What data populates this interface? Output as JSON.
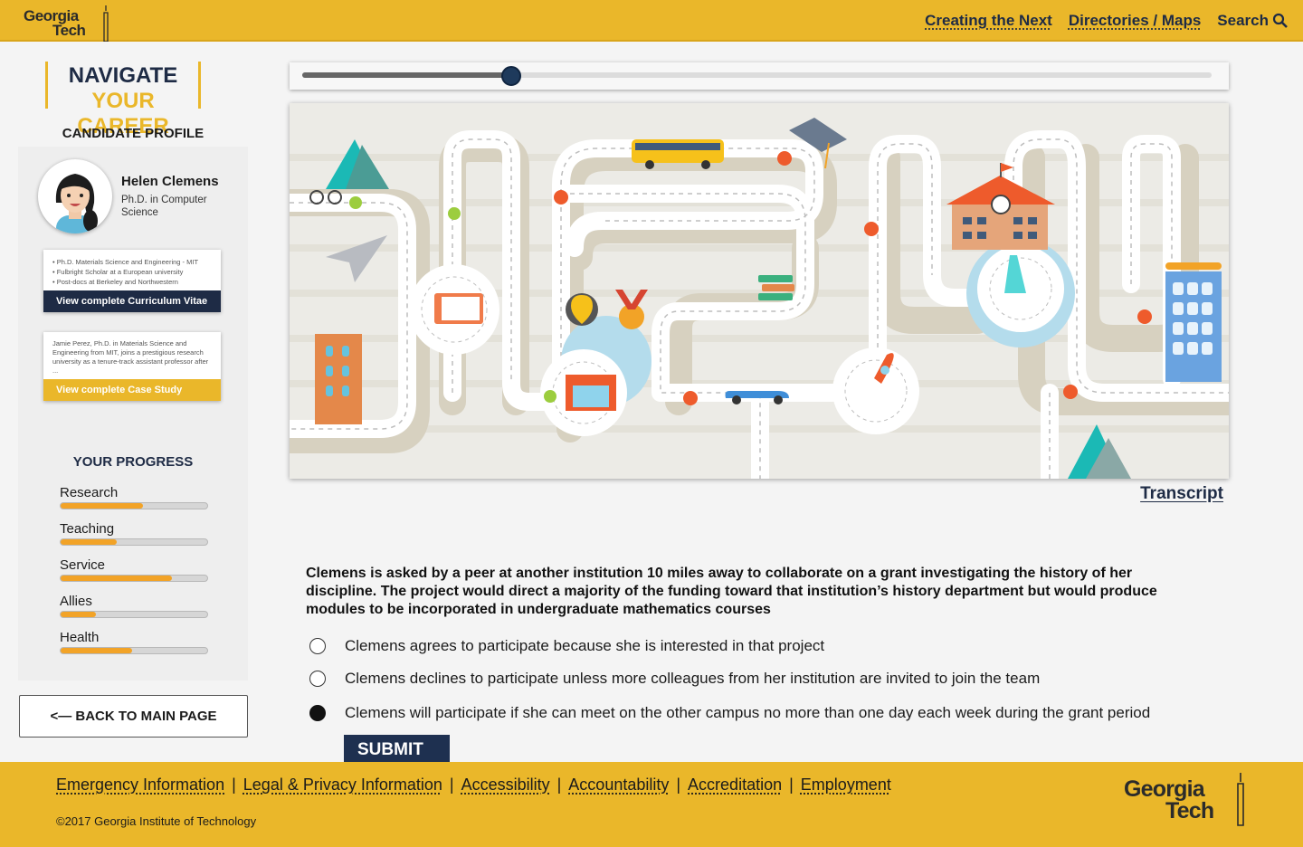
{
  "header": {
    "logo_line1": "Georgia",
    "logo_line2": "Tech",
    "nav": [
      "Creating the Next",
      "Directories / Maps",
      "Search"
    ]
  },
  "sidebar": {
    "brand_line1": "NAVIGATE",
    "brand_line2": "YOUR CAREER",
    "profile_heading": "CANDIDATE PROFILE",
    "candidate": {
      "name": "Helen Clemens",
      "degree": "Ph.D. in Computer Science"
    },
    "cv_card": {
      "bullets": [
        "• Ph.D. Materials Science and Engineering - MIT",
        "• Fulbright Scholar at a European university",
        "• Post-docs at Berkeley and Northwestern"
      ],
      "button": "View complete Curriculum Vitae"
    },
    "case_card": {
      "text": "Jamie Perez, Ph.D. in Materials Science and Engineering from MIT, joins a prestigious research university as a tenure-track assistant professor after ...",
      "button": "View complete Case Study"
    },
    "progress_heading": "YOUR PROGRESS",
    "progress": [
      {
        "label": "Research",
        "value": 0.56
      },
      {
        "label": "Teaching",
        "value": 0.38
      },
      {
        "label": "Service",
        "value": 0.76
      },
      {
        "label": "Allies",
        "value": 0.24
      },
      {
        "label": "Health",
        "value": 0.49
      }
    ],
    "back_button": "<— BACK TO MAIN PAGE"
  },
  "timeline": {
    "progress": 0.23
  },
  "map": {
    "alt_name": "career-path-board-illustration"
  },
  "transcript_link": "Transcript",
  "question": {
    "text": "Clemens is asked by a peer at another institution 10 miles away to collaborate on a grant investigating the history of her discipline. The project would direct a majority of the funding toward that institution’s history department but would produce modules to be incorporated in undergraduate mathematics courses",
    "options": [
      {
        "label": "Clemens agrees to participate because she is interested in that project",
        "selected": false
      },
      {
        "label": "Clemens declines to participate unless more colleagues from her institution are invited to join the team",
        "selected": false
      },
      {
        "label": "Clemens will participate if she can meet on the other campus no more than one day each week during the grant period",
        "selected": true
      }
    ],
    "submit": "SUBMIT"
  },
  "footer": {
    "links": [
      "Emergency Information",
      "Legal & Privacy Information",
      "Accessibility",
      "Accountability",
      "Accreditation",
      "Employment"
    ],
    "separator": "|",
    "copyright": "©2017 Georgia Institute of Technology",
    "logo_line1": "Georgia",
    "logo_line2": "Tech"
  },
  "colors": {
    "gold": "#eab72a",
    "navy": "#1e2b45",
    "progress_fill": "#f2a327",
    "case_button": "#eab72a",
    "cv_button": "#1e2b45"
  }
}
